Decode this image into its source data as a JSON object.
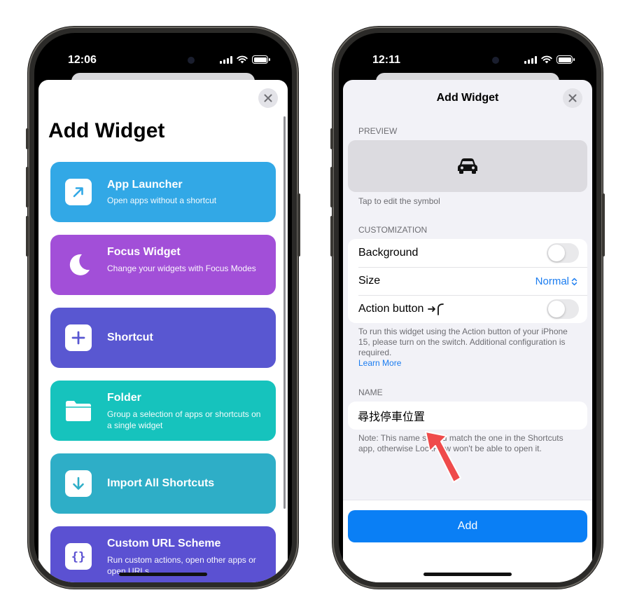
{
  "left_phone": {
    "time": "12:06",
    "title": "Add Widget",
    "cards": [
      {
        "title": "App Launcher",
        "subtitle": "Open apps without a shortcut",
        "color": "#32a8e6",
        "icon": "arrow-up-right-icon"
      },
      {
        "title": "Focus Widget",
        "subtitle": "Change your widgets with Focus Modes",
        "color": "#a24fd8",
        "icon": "moon-icon"
      },
      {
        "title": "Shortcut",
        "subtitle": "",
        "color": "#5957d1",
        "icon": "plus-icon"
      },
      {
        "title": "Folder",
        "subtitle": "Group a selection of apps or shortcuts on a single widget",
        "color": "#16c3bd",
        "icon": "folder-icon"
      },
      {
        "title": "Import All Shortcuts",
        "subtitle": "",
        "color": "#2eaec7",
        "icon": "download-arrow-icon"
      },
      {
        "title": "Custom URL Scheme",
        "subtitle": "Run custom actions, open other apps or open URLs",
        "color": "#5b51d2",
        "icon": "braces-icon"
      }
    ]
  },
  "right_phone": {
    "time": "12:11",
    "title": "Add Widget",
    "preview_header": "PREVIEW",
    "preview_icon": "car-icon",
    "preview_note": "Tap to edit the symbol",
    "customization_header": "CUSTOMIZATION",
    "background_label": "Background",
    "background_on": false,
    "size_label": "Size",
    "size_value": "Normal",
    "action_button_label": "Action button",
    "action_button_on": false,
    "action_note": "To run this widget using the Action button of your iPhone 15, please turn on the switch. Additional configuration is required.",
    "learn_more": "Learn More",
    "name_header": "NAME",
    "name_value": "尋找停車位置",
    "name_note": "Note: This name should match the one in the Shortcuts app, otherwise LockFlow won't be able to open it.",
    "add_label": "Add"
  },
  "colors": {
    "accent": "#0a7ff5",
    "annotation_arrow": "#ef4b4b"
  }
}
